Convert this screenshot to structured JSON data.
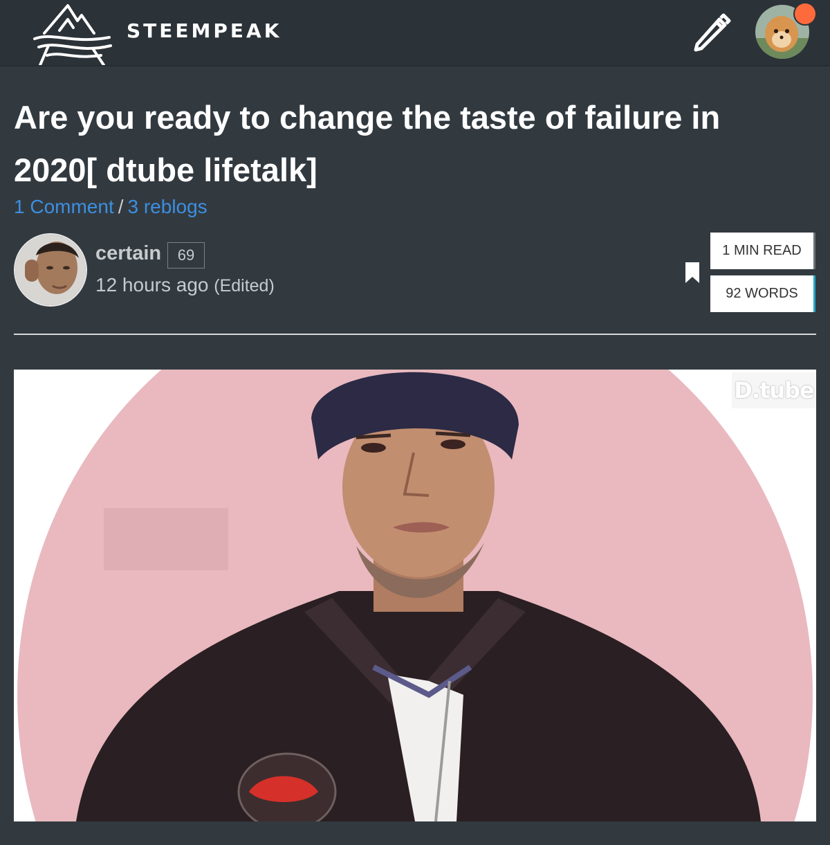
{
  "header": {
    "brand": "STEEMPEAK",
    "edit_icon": "pencil-icon",
    "notification_color": "#ff6a3d"
  },
  "post": {
    "title": "Are you ready to change the taste of failure in 2020[ dtube lifetalk]",
    "comments_label": "1 Comment",
    "separator": "/",
    "reblogs_label": "3 reblogs",
    "author": "certain",
    "reputation": "69",
    "time": "12 hours ago",
    "edited": "(Edited)",
    "read_time": "1 MIN READ",
    "word_count": "92 WORDS"
  },
  "video": {
    "watermark": "D.tube"
  },
  "colors": {
    "background": "#323a40",
    "link": "#3d8fe0",
    "accent_words": "#23a9c8"
  }
}
